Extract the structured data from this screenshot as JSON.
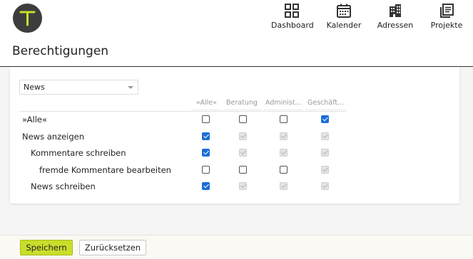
{
  "header": {
    "nav": [
      {
        "label": "Dashboard",
        "icon": "dashboard-icon"
      },
      {
        "label": "Kalender",
        "icon": "calendar-icon"
      },
      {
        "label": "Adressen",
        "icon": "building-icon"
      },
      {
        "label": "Projekte",
        "icon": "projects-icon"
      }
    ]
  },
  "page": {
    "title": "Berechtigungen"
  },
  "module_select": {
    "value": "News"
  },
  "table": {
    "columns": [
      "»Alle«",
      "Beratung",
      "Administ...",
      "Geschäft..."
    ],
    "rows": [
      {
        "label": "»Alle«",
        "cells": [
          "unchecked",
          "unchecked",
          "unchecked",
          "checked"
        ]
      },
      {
        "label": "News anzeigen",
        "cells": [
          "checked",
          "disabled",
          "disabled",
          "disabled"
        ]
      },
      {
        "label": "Kommentare schreiben",
        "cells": [
          "checked",
          "disabled",
          "disabled",
          "disabled"
        ]
      },
      {
        "label": "fremde Kommentare bearbeiten",
        "cells": [
          "unchecked",
          "unchecked",
          "unchecked",
          "disabled"
        ]
      },
      {
        "label": "News schreiben",
        "cells": [
          "checked",
          "disabled",
          "disabled",
          "disabled"
        ]
      }
    ]
  },
  "footer": {
    "save_label": "Speichern",
    "reset_label": "Zurücksetzen"
  },
  "colors": {
    "accent": "#c9de2b",
    "logo_bg": "#3d3d3d",
    "checkbox_checked": "#1a6ed8"
  }
}
